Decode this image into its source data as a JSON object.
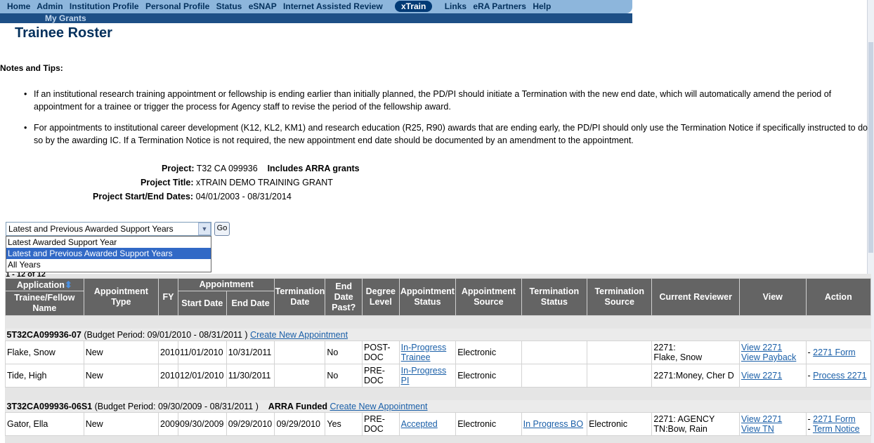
{
  "nav": {
    "items": [
      "Home",
      "Admin",
      "Institution Profile",
      "Personal Profile",
      "Status",
      "eSNAP",
      "Internet Assisted Review"
    ],
    "active": "xTrain",
    "items_after": [
      "Links",
      "eRA Partners",
      "Help"
    ],
    "sub": "My Grants"
  },
  "page_title": "Trainee Roster",
  "notes_title": "Notes and Tips:",
  "notes": [
    "If an institutional research training appointment or fellowship is ending earlier than initially planned, the PD/PI should initiate a Termination with the new end date, which will automatically amend the period of appointment for a trainee or trigger the process for Agency staff to revise the period of the fellowship award.",
    "For appointments to institutional career development (K12, KL2, KM1) and research education (R25, R90) awards that are ending early, the PD/PI should only use the Termination Notice if specifically instructed to do so by the awarding IC.  If a Termination Notice is not required, the new appointment end date should be documented by an amendment to the appointment."
  ],
  "project": {
    "label": "Project:",
    "value": "T32 CA 099936",
    "arra": "Includes ARRA grants",
    "title_label": "Project Title:",
    "title": "xTRAIN DEMO TRAINING GRANT",
    "dates_label": "Project Start/End Dates:",
    "dates": "04/01/2003 - 08/31/2014"
  },
  "filter": {
    "selected": "Latest and Previous Awarded Support Years",
    "go": "Go",
    "options": [
      "Latest Awarded Support Year",
      "Latest and Previous Awarded Support Years",
      "All Years"
    ]
  },
  "pager": "1 - 12 of 12",
  "headers": {
    "application": "Application",
    "trainee": "Trainee/Fellow Name",
    "appt_type": "Appointment Type",
    "fy": "FY",
    "appointment": "Appointment",
    "start": "Start Date",
    "end": "End Date",
    "term_date": "Termination Date",
    "end_past": "End Date Past?",
    "degree": "Degree Level",
    "appt_status": "Appointment Status",
    "appt_source": "Appointment Source",
    "term_status": "Termination Status",
    "term_source": "Termination Source",
    "reviewer": "Current Reviewer",
    "view": "View",
    "action": "Action"
  },
  "periods": [
    {
      "grant": "5T32CA099936-07",
      "budget": "(Budget Period: 09/01/2010 - 08/31/2011 )",
      "arra": "",
      "link": "Create New Appointment",
      "rows": [
        {
          "name": "Flake, Snow",
          "type": "New",
          "fy": "2010",
          "start": "11/01/2010",
          "end": "10/31/2011",
          "term": "",
          "past": "No",
          "degree": "POST-DOC",
          "status": "In-Progress Trainee",
          "source": "Electronic",
          "tstatus": "",
          "tsource": "",
          "reviewer": "2271:\nFlake, Snow",
          "view1": "View 2271",
          "view2": "View Payback",
          "action1_prefix": "- ",
          "action1": "2271 Form",
          "action2": ""
        },
        {
          "name": "Tide, High",
          "type": "New",
          "fy": "2010",
          "start": "12/01/2010",
          "end": "11/30/2011",
          "term": "",
          "past": "No",
          "degree": "PRE-DOC",
          "status": "In-Progress PI",
          "source": "Electronic",
          "tstatus": "",
          "tsource": "",
          "reviewer": "2271:Money, Cher D",
          "view1": "View 2271",
          "view2": "",
          "action1_prefix": "- ",
          "action1": "Process 2271",
          "action2": ""
        }
      ]
    },
    {
      "grant": "3T32CA099936-06S1",
      "budget": "(Budget Period: 09/30/2009 - 08/31/2011 )",
      "arra": "ARRA Funded",
      "link": "Create New Appointment",
      "rows": [
        {
          "name": "Gator, Ella",
          "type": "New",
          "fy": "2009",
          "start": "09/30/2009",
          "end": "09/29/2010",
          "term": "09/29/2010",
          "past": "Yes",
          "degree": "PRE-DOC",
          "status": "Accepted",
          "source": "Electronic",
          "tstatus": "In Progress BO",
          "tsource": "Electronic",
          "reviewer": "2271: AGENCY TN:Bow, Rain",
          "view1": "View 2271",
          "view2": "View TN",
          "action1_prefix": "- ",
          "action1": "2271 Form",
          "action2": "Term Notice"
        }
      ]
    }
  ]
}
